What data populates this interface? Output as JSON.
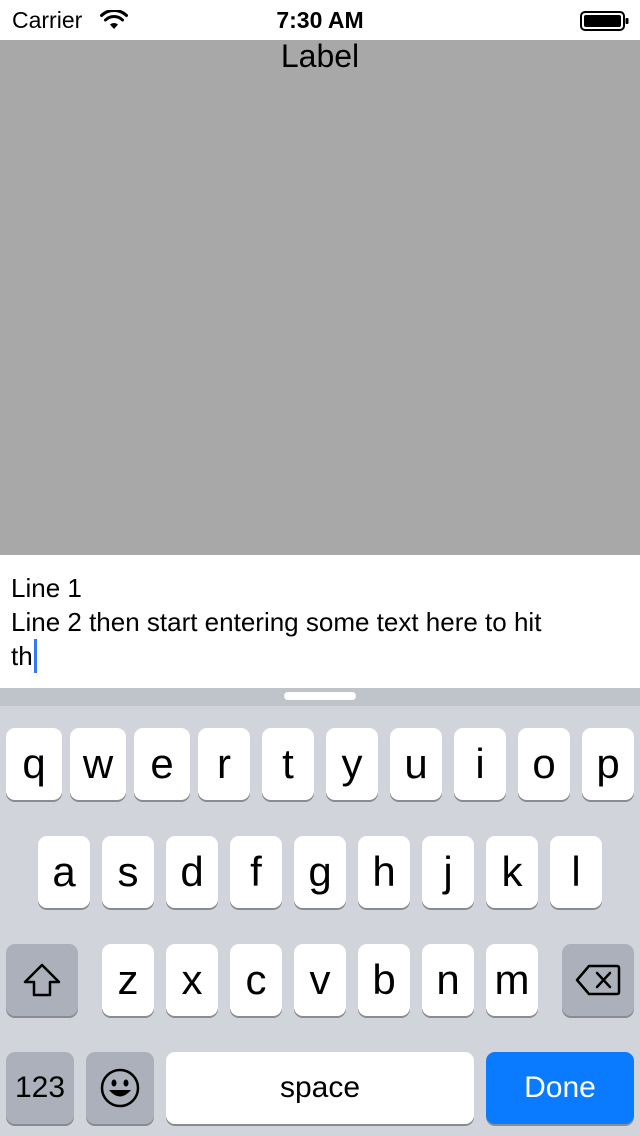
{
  "status_bar": {
    "carrier": "Carrier",
    "time": "7:30 AM"
  },
  "content": {
    "label": "Label"
  },
  "text_view": {
    "lines": [
      "Line 1",
      "Line 2 then start entering some text here to hit",
      "th"
    ]
  },
  "keyboard": {
    "row1": [
      "q",
      "w",
      "e",
      "r",
      "t",
      "y",
      "u",
      "i",
      "o",
      "p"
    ],
    "row2": [
      "a",
      "s",
      "d",
      "f",
      "g",
      "h",
      "j",
      "k",
      "l"
    ],
    "row3": [
      "z",
      "x",
      "c",
      "v",
      "b",
      "n",
      "m"
    ],
    "numbers_label": "123",
    "space_label": "space",
    "done_label": "Done"
  },
  "colors": {
    "content_background": "#a8a8a8",
    "keyboard_background": "#d1d4da",
    "done_key": "#0a7aff",
    "caret": "#3478f6"
  },
  "icons": [
    "wifi-icon",
    "battery-icon",
    "shift-icon",
    "delete-icon",
    "emoji-icon"
  ]
}
